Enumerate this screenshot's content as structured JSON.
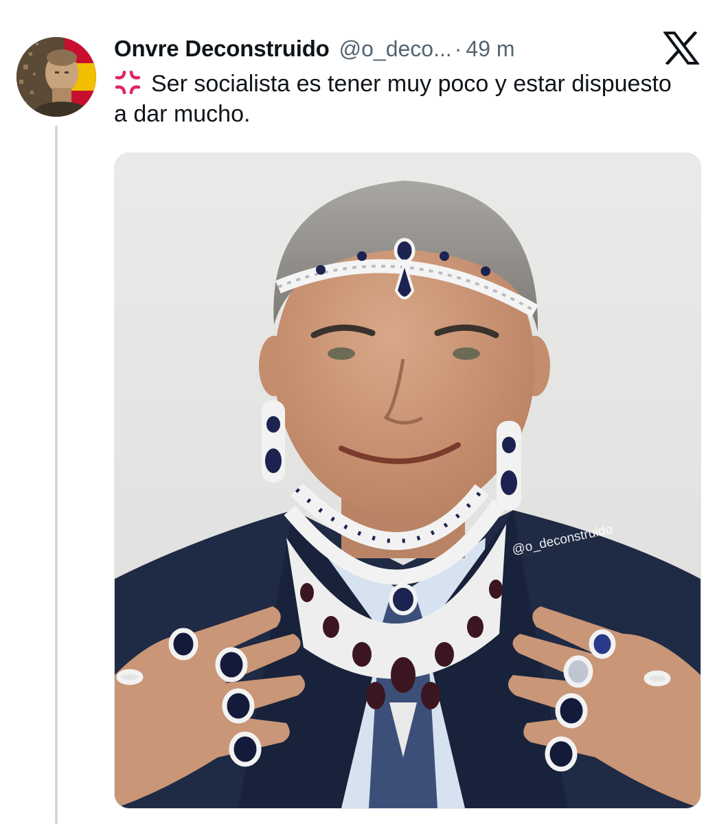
{
  "tweet": {
    "author": {
      "display_name": "Onvre Deconstruido",
      "handle": "@o_deco...",
      "avatar": "avatar-image"
    },
    "separator": "·",
    "timestamp": "49 m",
    "platform_icon": "x-logo-icon",
    "text_icon": "anger-symbol-icon",
    "text": "Ser socialista es tener muy poco y estar dispuesto a dar mucho.",
    "media": {
      "watermark": "@o_deconstruido"
    }
  },
  "colors": {
    "text_primary": "#0f1419",
    "text_secondary": "#536471",
    "thread_line": "#cfd9de",
    "anger_icon": "#e0245e"
  }
}
